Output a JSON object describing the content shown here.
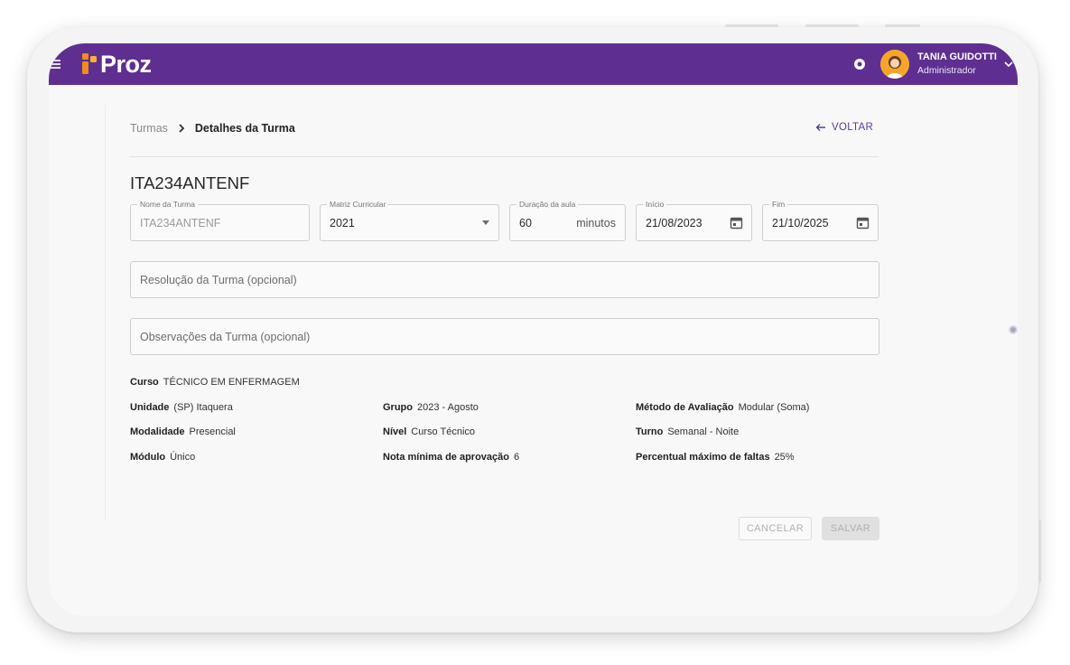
{
  "app": {
    "logo_text": "Proz",
    "brand_color": "#5e2f91",
    "accent_color": "#f08c1e"
  },
  "header": {
    "user_name": "TANIA GUIDOTTI",
    "user_role": "Administrador",
    "icons": [
      "menu-icon",
      "bell-icon",
      "avatar",
      "chevron-down-icon"
    ]
  },
  "breadcrumb": {
    "parent": "Turmas",
    "current": "Detalhes da Turma"
  },
  "back_label": "VOLTAR",
  "class_title": "ITA234ANTENF",
  "form": {
    "nome": {
      "label": "Nome da Turma",
      "value": "ITA234ANTENF"
    },
    "matriz": {
      "label": "Matriz Curricular",
      "value": "2021"
    },
    "duracao": {
      "label": "Duração da aula",
      "value": "60",
      "suffix": "minutos"
    },
    "inicio": {
      "label": "Início",
      "value": "21/08/2023"
    },
    "fim": {
      "label": "Fim",
      "value": "21/10/2025"
    },
    "resolucao_placeholder": "Resolução da Turma (opcional)",
    "observacoes_placeholder": "Observações da Turma (opcional)"
  },
  "details": {
    "curso": {
      "label": "Curso",
      "value": "TÉCNICO EM ENFERMAGEM"
    },
    "unidade": {
      "label": "Unidade",
      "value": "(SP) Itaquera"
    },
    "grupo": {
      "label": "Grupo",
      "value": "2023 - Agosto"
    },
    "metodo": {
      "label": "Método de Avaliação",
      "value": "Modular (Soma)"
    },
    "modalidade": {
      "label": "Modalidade",
      "value": "Presencial"
    },
    "nivel": {
      "label": "Nível",
      "value": "Curso Técnico"
    },
    "turno": {
      "label": "Turno",
      "value": "Semanal - Noite"
    },
    "modulo": {
      "label": "Módulo",
      "value": "Único"
    },
    "nota": {
      "label": "Nota mínima de aprovação",
      "value": "6"
    },
    "faltas": {
      "label": "Percentual máximo de faltas",
      "value": "25%"
    }
  },
  "actions": {
    "cancel": "CANCELAR",
    "save": "SALVAR"
  }
}
